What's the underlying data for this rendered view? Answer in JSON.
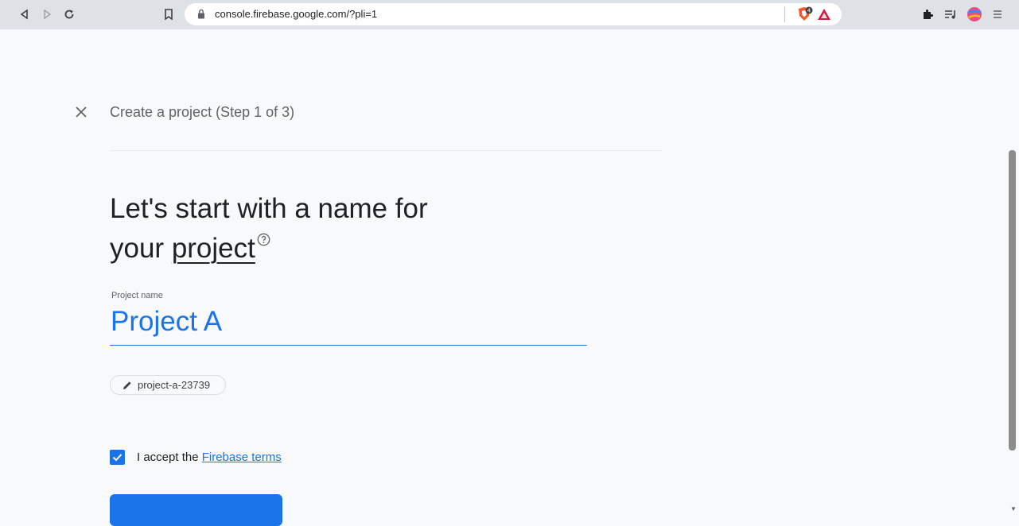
{
  "browser": {
    "url": "console.firebase.google.com/?pli=1",
    "icons": {
      "back": "back-icon",
      "forward": "forward-icon",
      "reload": "reload-icon",
      "bookmark": "bookmark-icon",
      "lock": "lock-icon",
      "brave": "brave-shield-icon",
      "rewards": "brave-rewards-icon",
      "extensions": "extensions-icon",
      "playlist": "playlist-icon",
      "profile": "profile-avatar-icon",
      "menu": "menu-icon"
    },
    "shield_badge": "4"
  },
  "page": {
    "step_title": "Create a project (Step 1 of 3)",
    "heading_line1": "Let's start with a name for",
    "heading_line2_prefix": "your ",
    "heading_line2_link": "project",
    "project_name_label": "Project name",
    "project_name_value": "Project A",
    "project_id": "project-a-23739",
    "accept_text": "I accept the ",
    "accept_link": "Firebase terms",
    "accept_checked": true
  },
  "colors": {
    "accent": "#1a73e8",
    "background": "#f8f9fa",
    "toolbar": "#dee1e6"
  }
}
